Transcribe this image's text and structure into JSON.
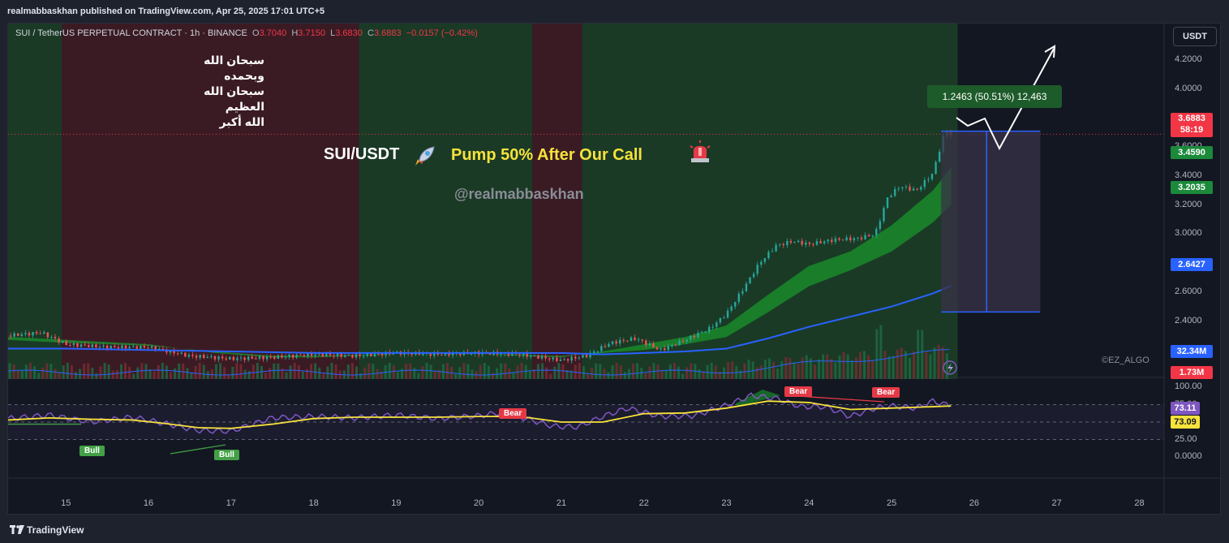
{
  "header": {
    "publish_line": "realmabbaskhan published on TradingView.com, Apr 25, 2025 17:01 UTC+5"
  },
  "legend": {
    "symbol": "SUI / TetherUS PERPETUAL CONTRACT · 1h · BINANCE",
    "open_label": "O",
    "open": "3.7040",
    "high_label": "H",
    "high": "3.7150",
    "low_label": "L",
    "low": "3.6830",
    "close_label": "C",
    "close": "3.6883",
    "change": "−0.0157 (−0.42%)"
  },
  "currency_button": "USDT",
  "annotations": {
    "arabic_line1": "سبحان الله وبحمده",
    "arabic_line2": "سبحان الله العظيم",
    "arabic_line3": "الله أكبر",
    "pair_title": "SUI/USDT",
    "pump_text": "Pump 50% After Our Call",
    "handle": "@realmabbaskhan",
    "measure": "1.2463 (50.51%) 12,463",
    "watermark": "©EZ_ALGO"
  },
  "price_tags": [
    {
      "label": "3.6883",
      "sub": "58:19",
      "color": "#f23645"
    },
    {
      "label": "3.4590",
      "color": "#1b8a3a"
    },
    {
      "label": "3.2035",
      "color": "#1b8a3a"
    },
    {
      "label": "2.6427",
      "color": "#2962ff"
    },
    {
      "label": "32.34M",
      "color": "#2962ff"
    },
    {
      "label": "1.73M",
      "color": "#f23645"
    }
  ],
  "rsi_tags": [
    {
      "label": "73.11",
      "color": "#7e57c2"
    },
    {
      "label": "73.09",
      "color": "#f7e23b"
    }
  ],
  "divergence_labels": [
    {
      "label": "Bull",
      "kind": "bull"
    },
    {
      "label": "Bull",
      "kind": "bull"
    },
    {
      "label": "Bear",
      "kind": "bear"
    },
    {
      "label": "Bear",
      "kind": "bear"
    },
    {
      "label": "Bear",
      "kind": "bear"
    }
  ],
  "footer": {
    "brand": "TradingView"
  },
  "chart_data": {
    "type": "candlestick",
    "ylim": [
      2.0,
      4.25
    ],
    "price_ticks": [
      "4.2000",
      "4.0000",
      "3.8000",
      "3.6000",
      "3.4000",
      "3.2000",
      "3.0000",
      "2.8000",
      "2.6000",
      "2.4000",
      "2.2000"
    ],
    "rsi_ylim": [
      0,
      100
    ],
    "rsi_ticks": [
      "100.00",
      "75.00",
      "50.00",
      "25.00",
      "0.0000"
    ],
    "x_tick_labels": [
      "15",
      "16",
      "17",
      "18",
      "19",
      "20",
      "21",
      "22",
      "23",
      "24",
      "25",
      "26",
      "27",
      "28"
    ],
    "x_tick_values": [
      15,
      16,
      17,
      18,
      19,
      20,
      21,
      22,
      23,
      24,
      25,
      26,
      27,
      28
    ],
    "x_range": [
      14.3,
      28.3
    ],
    "price_path": {
      "x": [
        14.3,
        14.7,
        15.0,
        15.5,
        16.0,
        16.5,
        17.0,
        17.5,
        18.0,
        18.5,
        19.0,
        19.5,
        20.0,
        20.5,
        21.0,
        21.3,
        21.6,
        21.9,
        22.2,
        22.5,
        22.8,
        23.0,
        23.2,
        23.4,
        23.6,
        23.8,
        24.0,
        24.3,
        24.6,
        24.8,
        24.95,
        25.1,
        25.3,
        25.5,
        25.65,
        25.72
      ],
      "y": [
        2.3,
        2.32,
        2.24,
        2.22,
        2.22,
        2.16,
        2.14,
        2.15,
        2.17,
        2.16,
        2.18,
        2.17,
        2.18,
        2.17,
        2.13,
        2.16,
        2.25,
        2.28,
        2.2,
        2.27,
        2.35,
        2.45,
        2.62,
        2.8,
        2.92,
        2.95,
        2.93,
        2.96,
        2.97,
        3.0,
        3.25,
        3.33,
        3.3,
        3.42,
        3.72,
        3.688
      ]
    },
    "ema_fast": {
      "x": [
        14.3,
        15.0,
        16.0,
        16.8,
        17.5,
        18.0,
        19.0,
        20.0,
        21.0,
        21.5,
        22.0,
        22.5,
        23.0,
        23.5,
        24.0,
        24.5,
        25.0,
        25.5,
        25.72
      ],
      "y": [
        2.29,
        2.27,
        2.24,
        2.18,
        2.15,
        2.15,
        2.17,
        2.17,
        2.15,
        2.19,
        2.24,
        2.29,
        2.37,
        2.58,
        2.78,
        2.88,
        3.06,
        3.3,
        3.459
      ]
    },
    "ema_slow": {
      "x": [
        14.3,
        15.0,
        16.0,
        16.8,
        17.5,
        18.0,
        19.0,
        20.0,
        21.0,
        21.5,
        22.0,
        22.5,
        23.0,
        23.5,
        24.0,
        24.5,
        25.0,
        25.5,
        25.72
      ],
      "y": [
        2.27,
        2.25,
        2.23,
        2.19,
        2.16,
        2.16,
        2.17,
        2.17,
        2.16,
        2.18,
        2.2,
        2.24,
        2.29,
        2.46,
        2.64,
        2.75,
        2.88,
        3.08,
        3.2035
      ]
    },
    "ma_blue": {
      "x": [
        14.3,
        15.0,
        16.0,
        17.0,
        18.0,
        19.0,
        20.0,
        21.0,
        21.5,
        22.0,
        22.5,
        23.0,
        23.5,
        24.0,
        24.5,
        25.0,
        25.5,
        25.72
      ],
      "y": [
        2.21,
        2.21,
        2.2,
        2.19,
        2.18,
        2.18,
        2.18,
        2.18,
        2.17,
        2.18,
        2.19,
        2.21,
        2.28,
        2.36,
        2.43,
        2.5,
        2.59,
        2.6427
      ]
    },
    "zones": [
      {
        "x0": 14.3,
        "x1": 14.95,
        "color": "green"
      },
      {
        "x0": 14.95,
        "x1": 18.55,
        "color": "red"
      },
      {
        "x0": 18.55,
        "x1": 20.65,
        "color": "green"
      },
      {
        "x0": 20.65,
        "x1": 21.25,
        "color": "red"
      },
      {
        "x0": 21.25,
        "x1": 25.8,
        "color": "green"
      }
    ],
    "measure_range": {
      "x0": 25.6,
      "x1": 26.8,
      "y_low": 2.4628,
      "y_high": 3.7091
    },
    "current_price": 3.6883,
    "rsi_series": {
      "x": [
        14.3,
        14.8,
        15.3,
        15.8,
        16.2,
        16.6,
        17.0,
        17.5,
        18.0,
        18.5,
        19.0,
        19.5,
        20.0,
        20.3,
        20.6,
        20.9,
        21.2,
        21.5,
        21.8,
        22.2,
        22.6,
        23.0,
        23.3,
        23.6,
        23.9,
        24.2,
        24.5,
        24.8,
        25.0,
        25.3,
        25.5,
        25.72
      ],
      "y": [
        55,
        60,
        50,
        57,
        48,
        38,
        37,
        56,
        58,
        56,
        60,
        55,
        59,
        64,
        54,
        44,
        43,
        58,
        70,
        58,
        59,
        74,
        88,
        84,
        72,
        72,
        58,
        70,
        73,
        70,
        80,
        73.11
      ]
    },
    "rsi_ma": {
      "x": [
        14.3,
        14.8,
        15.3,
        15.8,
        16.2,
        16.6,
        17.0,
        17.5,
        18.0,
        18.5,
        19.0,
        19.5,
        20.0,
        20.5,
        21.0,
        21.5,
        22.0,
        22.5,
        23.0,
        23.5,
        24.0,
        24.5,
        25.0,
        25.5,
        25.72
      ],
      "y": [
        53,
        56,
        54,
        53,
        48,
        42,
        41,
        47,
        55,
        57,
        57,
        57,
        58,
        58,
        50,
        50,
        62,
        63,
        70,
        80,
        78,
        68,
        70,
        72,
        73.09
      ]
    },
    "volume_tags": [
      "32.34M",
      "1.73M"
    ]
  }
}
